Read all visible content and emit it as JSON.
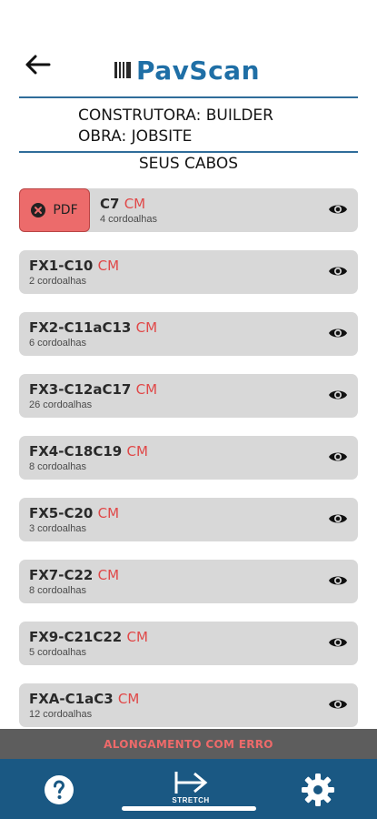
{
  "app": {
    "name": "PavScan",
    "brand_color": "#1f6fa6",
    "nav_color": "#1a5883"
  },
  "info": {
    "constructor_line": "CONSTRUTORA: BUILDER",
    "site_line": "OBRA: JOBSITE"
  },
  "section_title": "SEUS CABOS",
  "pdf_button": {
    "label": "PDF",
    "icon": "close-circle-icon"
  },
  "cables": [
    {
      "code": "C7",
      "tag": "CM",
      "strands": "4 cordoalhas",
      "has_pdf": true
    },
    {
      "code": "FX1-C10",
      "tag": "CM",
      "strands": "2 cordoalhas"
    },
    {
      "code": "FX2-C11aC13",
      "tag": "CM",
      "strands": "6 cordoalhas"
    },
    {
      "code": "FX3-C12aC17",
      "tag": "CM",
      "strands": "26 cordoalhas"
    },
    {
      "code": "FX4-C18C19",
      "tag": "CM",
      "strands": "8 cordoalhas"
    },
    {
      "code": "FX5-C20",
      "tag": "CM",
      "strands": "3 cordoalhas"
    },
    {
      "code": "FX7-C22",
      "tag": "CM",
      "strands": "8 cordoalhas"
    },
    {
      "code": "FX9-C21C22",
      "tag": "CM",
      "strands": "5 cordoalhas"
    },
    {
      "code": "FXA-C1aC3",
      "tag": "CM",
      "strands": "12 cordoalhas"
    }
  ],
  "error_banner": "ALONGAMENTO COM ERRO",
  "nav": {
    "help_icon": "question-circle-icon",
    "stretch_label": "STRETCH",
    "settings_icon": "gear-icon"
  }
}
